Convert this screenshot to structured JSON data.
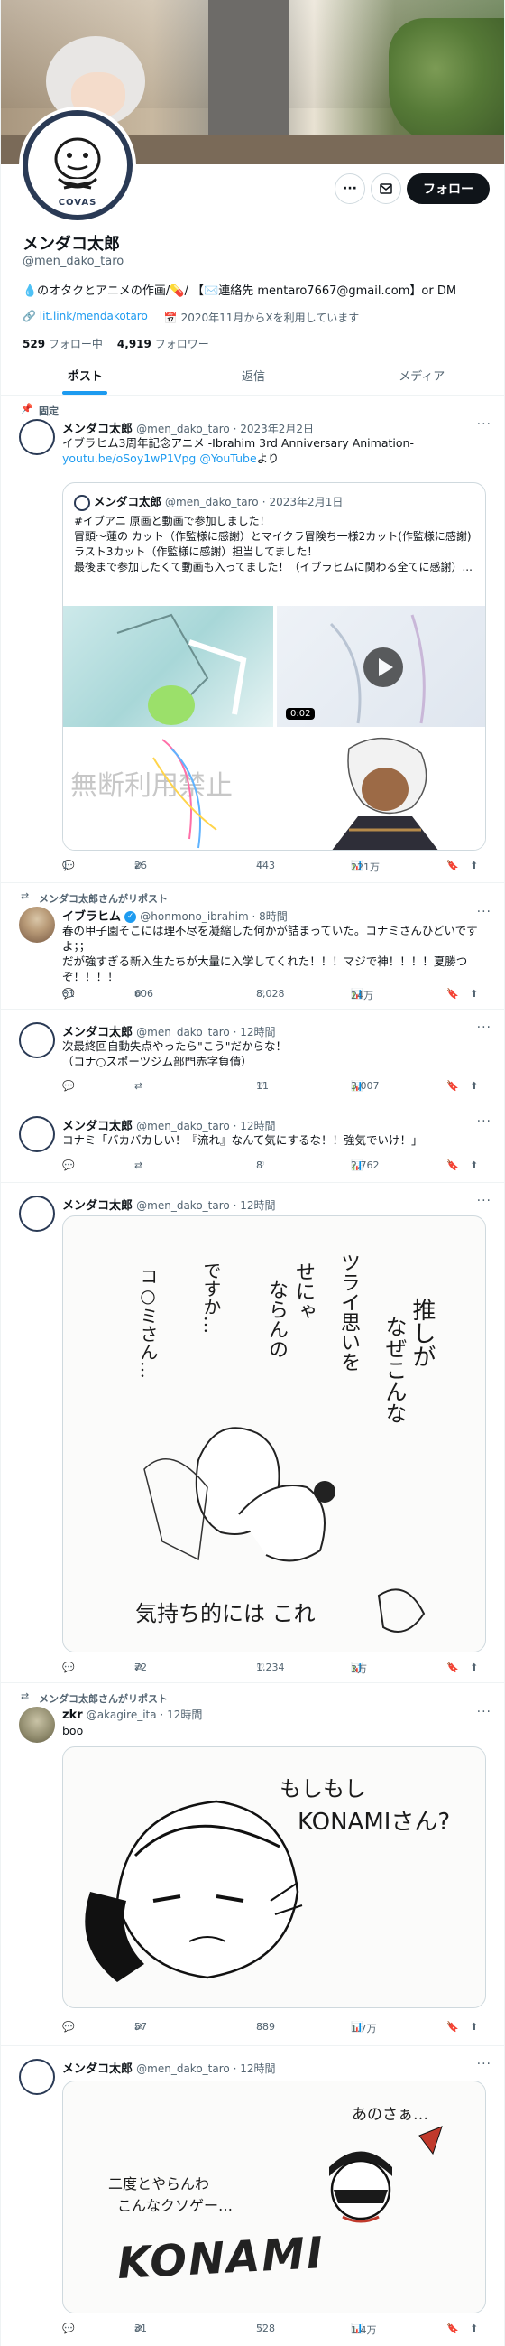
{
  "profile": {
    "name": "メンダコ太郎",
    "handle": "@men_dako_taro",
    "bio": "💧のオタクとアニメの作画/💊/ 【✉️連絡先 mentaro7667@gmail.com】or DM",
    "link": "lit.link/mendakotaro",
    "joined": "2020年11月からXを利用しています",
    "following_count": "529",
    "following_label": "フォロー中",
    "followers_count": "4,919",
    "followers_label": "フォロワー",
    "follow_button": "フォロー",
    "avatar_brand": "COVAS"
  },
  "tabs": [
    "ポスト",
    "返信",
    "メディア"
  ],
  "tweets": [
    {
      "context": "固定",
      "author": "メンダコ太郎",
      "handle": "@men_dako_taro",
      "date": "2023年2月2日",
      "text_line1": "イブラヒム3周年記念アニメ -Ibrahim 3rd Anniversary Animation-",
      "link1": "youtu.be/oSoy1wP1Vpg",
      "link2": "@YouTube",
      "text_tail": "より",
      "quote": {
        "author": "メンダコ太郎",
        "handle": "@men_dako_taro",
        "date": "2023年2月1日",
        "text": "#イブアニ 原画と動画で参加しました！\n冒頭〜蓮の カット（作監様に感謝）とマイクラ冒険ち一様2カット(作監様に感謝) ラスト3カット（作監様に感謝）担当してました！\n最後まで参加したくて動画も入ってました！（イブラヒムに関わる全てに感謝）...",
        "video_time": "0:02",
        "watermark": "無断利用禁止"
      },
      "replies": "1",
      "retweets": "26",
      "likes": "443",
      "views": "221万"
    },
    {
      "context": "メンダコ太郎さんがリポスト",
      "author": "イブラヒム",
      "handle": "@honmono_ibrahim",
      "date": "8時間",
      "text": "春の甲子園そこには理不尽を凝縮した何かが詰まっていた。コナミさんひどいですよ；；\nだが強すぎる新入生たちが大量に入学してくれた！！！マジで神！！！！夏勝つぞ！！！！",
      "replies": "81",
      "retweets": "606",
      "likes": "8,028",
      "views": "24万"
    },
    {
      "author": "メンダコ太郎",
      "handle": "@men_dako_taro",
      "date": "12時間",
      "text": "次最終回自動失点やったら\"こう\"だからな！\n（コナ○スポーツジム部門赤字負債）",
      "replies": "",
      "retweets": "",
      "likes": "11",
      "views": "3,007"
    },
    {
      "author": "メンダコ太郎",
      "handle": "@men_dako_taro",
      "date": "12時間",
      "text": "コナミ「バカバカしい！『流れ』なんて気にするな！！強気でいけ！」",
      "replies": "",
      "retweets": "",
      "likes": "8",
      "views": "2,762"
    },
    {
      "author": "メンダコ太郎",
      "handle": "@men_dako_taro",
      "date": "12時間",
      "drawing": {
        "t1": "推しが",
        "t2": "なぜこんな",
        "t3": "ツライ思いを",
        "t4": "せにゃ",
        "t5": "ならんの",
        "t6": "ですか…",
        "t7": "コ○ミさん…",
        "t8": "気持ち的には これ"
      },
      "replies": "",
      "retweets": "72",
      "likes": "1,234",
      "views": "3万"
    },
    {
      "context": "メンダコ太郎さんがリポスト",
      "author": "zkr",
      "handle": "@akagire_ita",
      "date": "12時間",
      "text": "boo",
      "drawing": {
        "t1": "もしもし",
        "t2": "KONAMIさん?"
      },
      "replies": "",
      "retweets": "57",
      "likes": "889",
      "views": "1.7万"
    },
    {
      "author": "メンダコ太郎",
      "handle": "@men_dako_taro",
      "date": "12時間",
      "drawing": {
        "t1": "あのさぁ…",
        "t2": "二度とやらんわ",
        "t3": "こんなクソゲー…",
        "t4": "KONAMI"
      },
      "replies": "",
      "retweets": "31",
      "likes": "528",
      "views": "1.4万"
    }
  ],
  "icons": {
    "reply": "💬",
    "retweet": "⇄",
    "like": "♡",
    "views": "📊",
    "bookmark": "🔖",
    "share": "⬆"
  },
  "colors": {
    "accent": "#1d9bf0",
    "text": "#0f1419",
    "muted": "#536471"
  }
}
